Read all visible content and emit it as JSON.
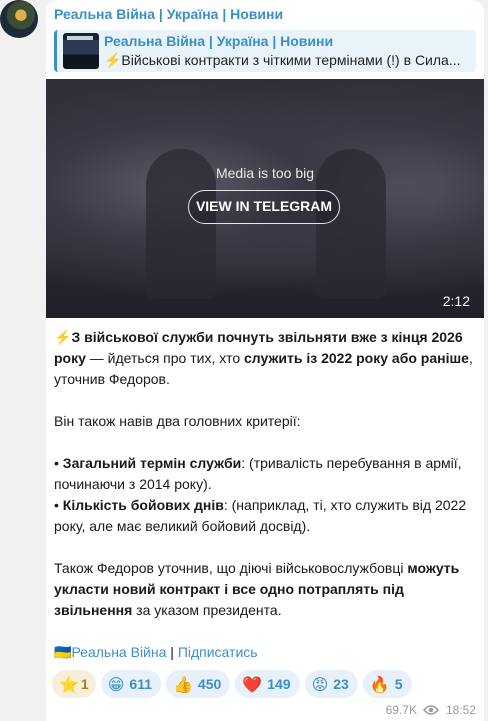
{
  "channel_name": "Реальна Війна | Україна | Новини",
  "reply": {
    "author": "Реальна Війна | Україна | Новини",
    "text": "⚡Військові контракти з чіткими термінами (!) в Сила..."
  },
  "media": {
    "message": "Media is too big",
    "button": "VIEW IN TELEGRAM",
    "duration": "2:12"
  },
  "post": {
    "p1_emoji": "⚡",
    "p1_bold": "З військової служби почнуть звільняти вже з кінця 2026 року",
    "p1_text_a": " — йдеться про тих, хто ",
    "p1_bold2": "служить із 2022 року або раніше",
    "p1_text_b": ", уточнив Федоров.",
    "p2": "Він також навів два головних критерії:",
    "c1_bullet": "• ",
    "c1_bold": "Загальний термін служби",
    "c1_text": ": (тривалість перебування в армії, починаючи з 2014 року).",
    "c2_bullet": "• ",
    "c2_bold": "Кількість бойових днів",
    "c2_text": ": (наприклад, ті, хто служить від 2022 року, але має великий бойовий досвід).",
    "p4_text": "Також Федоров уточнив, що діючі військовослужбовці ",
    "p4_bold": "можуть укласти новий контракт і все одно потраплять під звільнення",
    "p4_text_b": " за указом президента.",
    "footer_flag": "🇺🇦",
    "footer_link": "Реальна Війна",
    "footer_sep": " | ",
    "footer_subscribe": "Підписатись"
  },
  "reactions": [
    {
      "icon": "star-icon",
      "emoji": "⭐",
      "count": "1"
    },
    {
      "icon": "grin-emoji",
      "emoji": "😁",
      "count": "611"
    },
    {
      "icon": "thumbs-up-emoji",
      "emoji": "👍",
      "count": "450"
    },
    {
      "icon": "heart-emoji",
      "emoji": "❤️",
      "count": "149"
    },
    {
      "icon": "angry-emoji",
      "emoji": "😡",
      "count": "23"
    },
    {
      "icon": "fire-emoji",
      "emoji": "🔥",
      "count": "5"
    }
  ],
  "meta": {
    "views": "69.7K",
    "time": "18:52"
  },
  "colors": {
    "accent": "#3a8fc7",
    "background": "#f1f1f1"
  }
}
